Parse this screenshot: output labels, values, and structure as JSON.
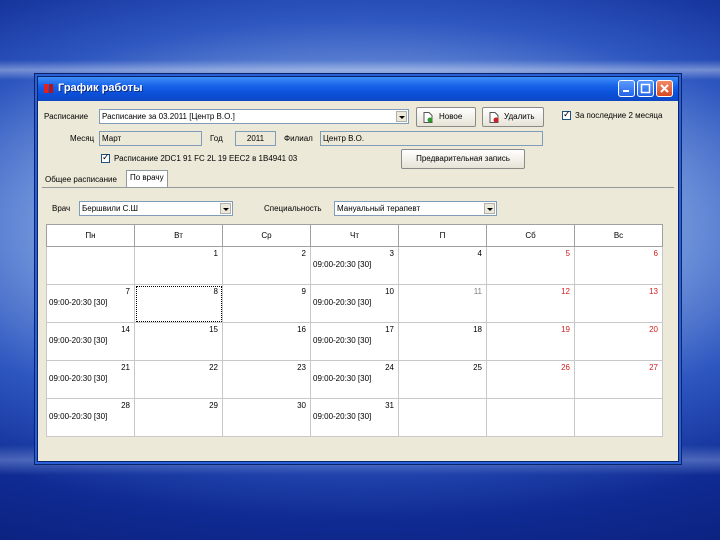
{
  "window": {
    "title": "График работы"
  },
  "form": {
    "schedule_label": "Расписание",
    "schedule_value": "Расписание за 03.2011 [Центр В.О.]",
    "new_button": "Новое",
    "delete_button": "Удалить",
    "last2_label": "За последние 2 месяца",
    "month_label": "Месяц",
    "month_value": "Март",
    "year_label": "Год",
    "year_value": "2011",
    "branch_label": "Филиал",
    "branch_value": "Центр В.О.",
    "check2_label": "Расписание 2DC1 91 FC 2L 19 EEC2 в 1B4941 03",
    "prelim_button": "Предварительная запись"
  },
  "tabs": [
    "Общее расписание",
    "По врачу"
  ],
  "filters": {
    "doctor_label": "Врач",
    "doctor_value": "Бершвили С.Ш",
    "specialty_label": "Специальность",
    "specialty_value": "Мануальный терапевт"
  },
  "calendar": {
    "headers": [
      "Пн",
      "Вт",
      "Ср",
      "Чт",
      "П",
      "Сб",
      "Вс"
    ],
    "weeks": [
      [
        {
          "day": "",
          "shift": ""
        },
        {
          "day": "1",
          "shift": ""
        },
        {
          "day": "2",
          "shift": ""
        },
        {
          "day": "3",
          "shift": "09:00-20:30 [30]"
        },
        {
          "day": "4",
          "shift": ""
        },
        {
          "day": "5",
          "shift": ""
        },
        {
          "day": "6",
          "shift": ""
        }
      ],
      [
        {
          "day": "7",
          "shift": "09:00-20:30 [30]"
        },
        {
          "day": "8",
          "shift": ""
        },
        {
          "day": "9",
          "shift": ""
        },
        {
          "day": "10",
          "shift": "09:00-20:30 [30]"
        },
        {
          "day": "11",
          "shift": ""
        },
        {
          "day": "12",
          "shift": ""
        },
        {
          "day": "13",
          "shift": ""
        }
      ],
      [
        {
          "day": "14",
          "shift": "09:00-20:30 [30]"
        },
        {
          "day": "15",
          "shift": ""
        },
        {
          "day": "16",
          "shift": ""
        },
        {
          "day": "17",
          "shift": "09:00-20:30 [30]"
        },
        {
          "day": "18",
          "shift": ""
        },
        {
          "day": "19",
          "shift": ""
        },
        {
          "day": "20",
          "shift": ""
        }
      ],
      [
        {
          "day": "21",
          "shift": "09:00-20:30 [30]"
        },
        {
          "day": "22",
          "shift": ""
        },
        {
          "day": "23",
          "shift": ""
        },
        {
          "day": "24",
          "shift": "09:00-20:30 [30]"
        },
        {
          "day": "25",
          "shift": ""
        },
        {
          "day": "26",
          "shift": ""
        },
        {
          "day": "27",
          "shift": ""
        }
      ],
      [
        {
          "day": "28",
          "shift": "09:00-20:30 [30]"
        },
        {
          "day": "29",
          "shift": ""
        },
        {
          "day": "30",
          "shift": ""
        },
        {
          "day": "31",
          "shift": "09:00-20:30 [30]"
        },
        {
          "day": "",
          "shift": ""
        },
        {
          "day": "",
          "shift": ""
        },
        {
          "day": "",
          "shift": ""
        }
      ]
    ]
  },
  "colors": {
    "weekend": "#d02020",
    "inactive": "#808080"
  }
}
